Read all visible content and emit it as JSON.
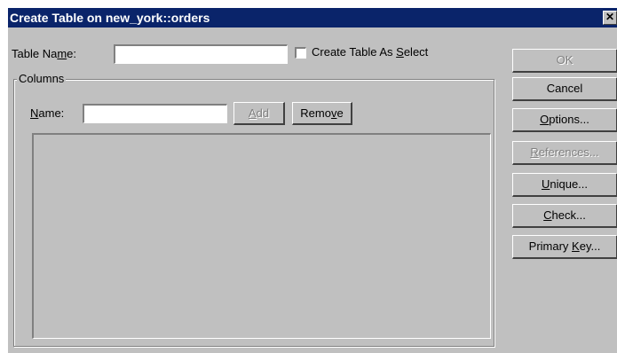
{
  "window": {
    "title": "Create Table on new_york::orders",
    "close": "✕"
  },
  "table_name": {
    "label_pre": "Table Na",
    "label_u": "m",
    "label_post": "e:",
    "value": ""
  },
  "create_as_select": {
    "label_pre": "Create Table As ",
    "label_u": "S",
    "label_post": "elect",
    "checked": false
  },
  "columns": {
    "group_label": "Columns",
    "name_label_u": "N",
    "name_label_post": "ame:",
    "name_value": "",
    "add": {
      "u": "A",
      "post": "dd"
    },
    "remove": {
      "pre": "Remo",
      "u": "v",
      "post": "e"
    }
  },
  "buttons": {
    "ok": "OK",
    "cancel": "Cancel",
    "options": {
      "u": "O",
      "post": "ptions..."
    },
    "references": {
      "u": "R",
      "post": "eferences..."
    },
    "unique": {
      "u": "U",
      "post": "nique..."
    },
    "check": {
      "u": "C",
      "post": "heck..."
    },
    "primary_key": {
      "pre": "Primary ",
      "u": "K",
      "post": "ey..."
    }
  }
}
